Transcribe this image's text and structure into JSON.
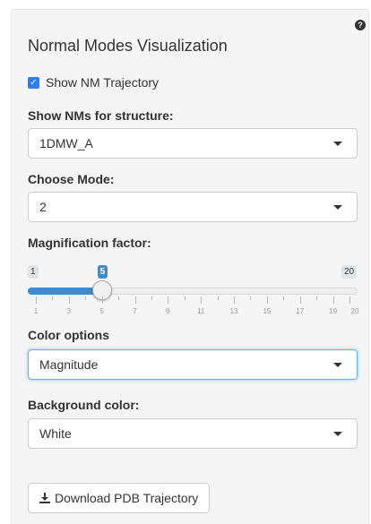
{
  "panel": {
    "title": "Normal Modes Visualization",
    "help_icon": "question-circle-icon",
    "help_glyph": "?"
  },
  "trajectory": {
    "label": "Show NM Trajectory",
    "checked": true,
    "check_glyph": "✓"
  },
  "structure": {
    "label": "Show NMs for structure:",
    "value": "1DMW_A"
  },
  "mode": {
    "label": "Choose Mode:",
    "value": "2"
  },
  "magnification": {
    "label": "Magnification factor:",
    "min": 1,
    "max": 20,
    "value": 5,
    "min_label": "1",
    "max_label": "20",
    "value_label": "5",
    "tick_labels": [
      "1",
      "3",
      "5",
      "7",
      "9",
      "11",
      "13",
      "15",
      "17",
      "19",
      "20"
    ]
  },
  "color_options": {
    "label": "Color options",
    "value": "Magnitude"
  },
  "background": {
    "label": "Background color:",
    "value": "White"
  },
  "download": {
    "label": "Download PDB Trajectory",
    "icon": "download-icon"
  },
  "colors": {
    "accent": "#428bca",
    "checkbox": "#2d7ff9",
    "panel_bg": "#f5f5f5"
  }
}
